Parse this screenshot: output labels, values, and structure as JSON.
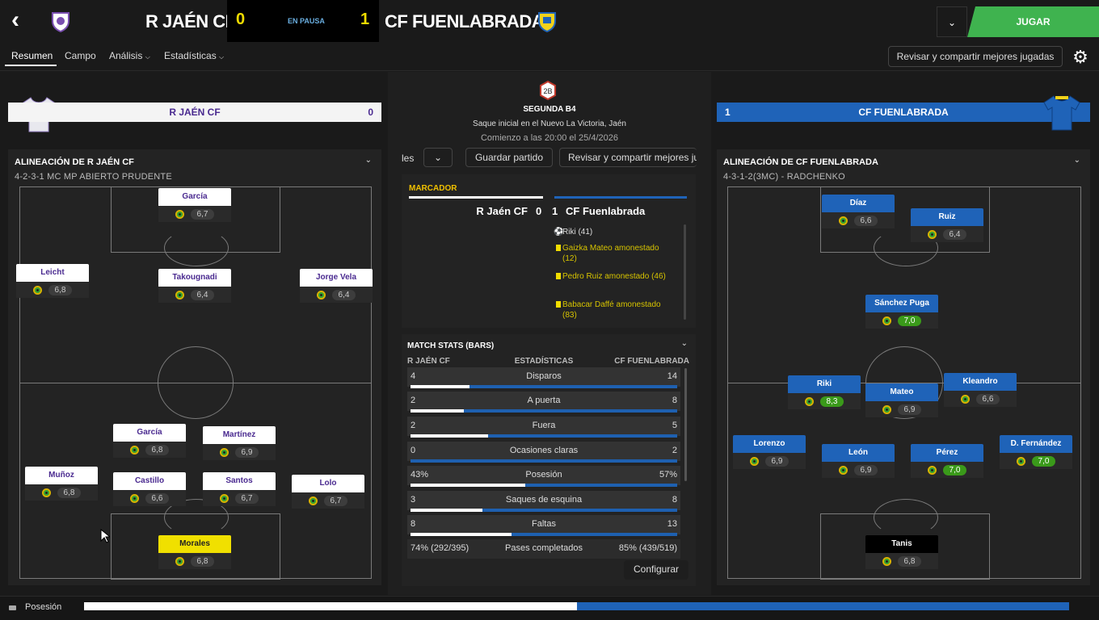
{
  "header": {
    "home_team": "R JAÉN CF",
    "away_team": "CF FUENLABRADA",
    "home_score": "0",
    "away_score": "1",
    "status": "EN PAUSA",
    "play_label": "JUGAR"
  },
  "tabs": {
    "resumen": "Resumen",
    "campo": "Campo",
    "analisis": "Análisis",
    "estadisticas": "Estadísticas",
    "review_button": "Revisar y compartir mejores jugadas"
  },
  "match_info": {
    "competition": "SEGUNDA B4",
    "kickoff_place": "Saque inicial en el Nuevo La Victoria, Jaén",
    "kickoff_time": "Comienzo a las 20:00 el 25/4/2026",
    "save_button": "Guardar partido",
    "review_button": "Revisar y compartir mejores ju",
    "left_stub": "les"
  },
  "home_panel": {
    "team_name": "R JAÉN CF",
    "score": "0",
    "lineup_title": "ALINEACIÓN DE R JAÉN CF",
    "formation": "4-2-3-1 MC MP ABIERTO PRUDENTE",
    "players": [
      {
        "name": "García",
        "rating": "6,7"
      },
      {
        "name": "Leicht",
        "rating": "6,8"
      },
      {
        "name": "Takougnadi",
        "rating": "6,4"
      },
      {
        "name": "Jorge Vela",
        "rating": "6,4"
      },
      {
        "name": "García",
        "rating": "6,8"
      },
      {
        "name": "Martínez",
        "rating": "6,9"
      },
      {
        "name": "Muñoz",
        "rating": "6,8"
      },
      {
        "name": "Castillo",
        "rating": "6,6"
      },
      {
        "name": "Santos",
        "rating": "6,7"
      },
      {
        "name": "Lolo",
        "rating": "6,7"
      },
      {
        "name": "Morales",
        "rating": "6,8"
      }
    ]
  },
  "away_panel": {
    "team_name": "CF FUENLABRADA",
    "score": "1",
    "lineup_title": "ALINEACIÓN DE CF FUENLABRADA",
    "formation": "4-3-1-2(3MC) - RADCHENKO",
    "players": [
      {
        "name": "Díaz",
        "rating": "6,6"
      },
      {
        "name": "Ruiz",
        "rating": "6,4"
      },
      {
        "name": "Sánchez Puga",
        "rating": "7,0"
      },
      {
        "name": "Riki",
        "rating": "8,3"
      },
      {
        "name": "Mateo",
        "rating": "6,9"
      },
      {
        "name": "Kleandro",
        "rating": "6,6"
      },
      {
        "name": "Lorenzo",
        "rating": "6,9"
      },
      {
        "name": "León",
        "rating": "6,9"
      },
      {
        "name": "Pérez",
        "rating": "7,0"
      },
      {
        "name": "D. Fernández",
        "rating": "7,0"
      },
      {
        "name": "Tanis",
        "rating": "6,8"
      }
    ]
  },
  "scoreboard": {
    "title": "MARCADOR",
    "home": "R Jaén CF",
    "home_score": "0",
    "away_score": "1",
    "away": "CF Fuenlabrada",
    "events": [
      {
        "text": "Riki (41)",
        "type": "goal"
      },
      {
        "text": "Gaizka Mateo amonestado (12)",
        "type": "yellow"
      },
      {
        "text": "Pedro Ruiz amonestado (46)",
        "type": "yellow"
      },
      {
        "text": "Babacar Daffé amonestado (83)",
        "type": "yellow"
      }
    ]
  },
  "stats": {
    "title": "MATCH STATS (BARS)",
    "home_header": "R JAÉN CF",
    "mid_header": "ESTADÍSTICAS",
    "away_header": "CF FUENLABRADA",
    "rows": [
      {
        "label": "Disparos",
        "home": "4",
        "away": "14",
        "home_frac": 0.22
      },
      {
        "label": "A puerta",
        "home": "2",
        "away": "8",
        "home_frac": 0.2
      },
      {
        "label": "Fuera",
        "home": "2",
        "away": "5",
        "home_frac": 0.29
      },
      {
        "label": "Ocasiones claras",
        "home": "0",
        "away": "2",
        "home_frac": 0.0
      },
      {
        "label": "Posesión",
        "home": "43%",
        "away": "57%",
        "home_frac": 0.43
      },
      {
        "label": "Saques de esquina",
        "home": "3",
        "away": "8",
        "home_frac": 0.27
      },
      {
        "label": "Faltas",
        "home": "8",
        "away": "13",
        "home_frac": 0.38
      }
    ],
    "passes": {
      "label": "Pases completados",
      "home": "74% (292/395)",
      "away": "85% (439/519)"
    },
    "configure": "Configurar"
  },
  "footer": {
    "label": "Posesión",
    "home_frac": 0.5
  }
}
